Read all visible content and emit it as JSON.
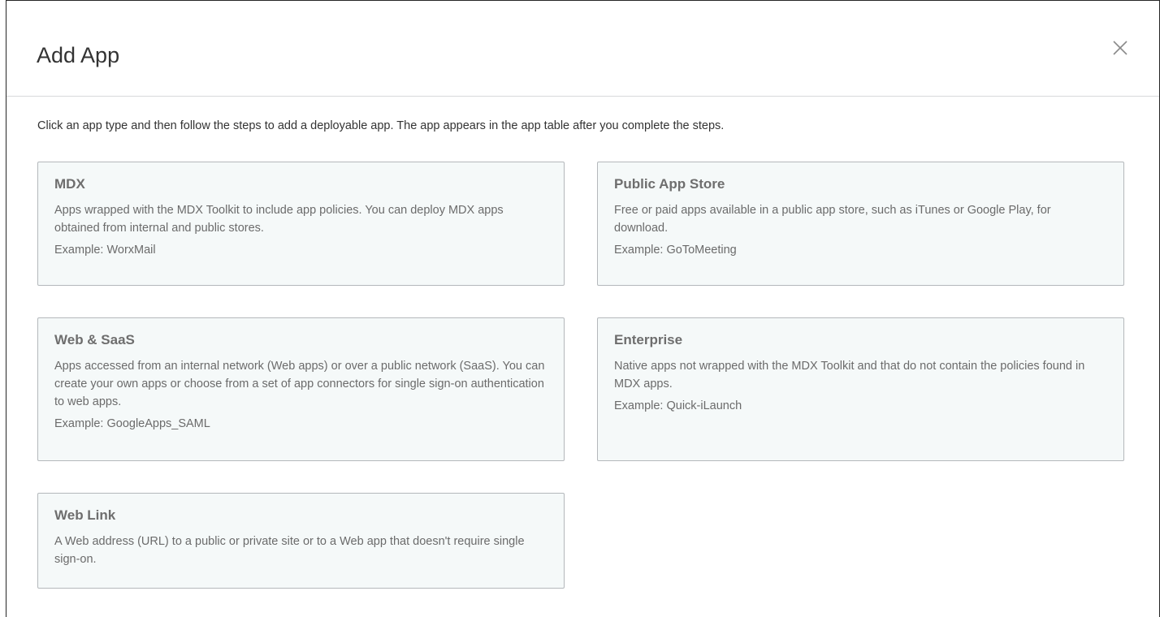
{
  "dialog": {
    "title": "Add App",
    "close_icon": "close-icon",
    "intro": "Click an app type and then follow the steps to add a deployable app. The app appears in the app table after you complete the steps."
  },
  "cards": [
    {
      "title": "MDX",
      "description": "Apps wrapped with the MDX Toolkit to include app policies. You can deploy MDX apps obtained from internal and public stores.",
      "example": "Example: WorxMail"
    },
    {
      "title": "Public App Store",
      "description": "Free or paid apps available in a public app store, such as iTunes or Google Play, for download.",
      "example": "Example: GoToMeeting"
    },
    {
      "title": "Web & SaaS",
      "description": "Apps accessed from an internal network (Web apps) or over a public network (SaaS). You can create your own apps or choose from a set of app connectors for single sign-on authentication to web apps.",
      "example": "Example: GoogleApps_SAML"
    },
    {
      "title": "Enterprise",
      "description": "Native apps not wrapped with the MDX Toolkit and that do not contain the policies found in MDX apps.",
      "example": "Example: Quick-iLaunch"
    },
    {
      "title": "Web Link",
      "description": "A Web address (URL) to a public or private site or to a Web app that doesn't require single sign-on."
    }
  ],
  "colors": {
    "card_background": "#f5f9f9",
    "card_border": "#b4b8bb",
    "title_text": "#333333",
    "muted_text": "#6b6b6b"
  }
}
